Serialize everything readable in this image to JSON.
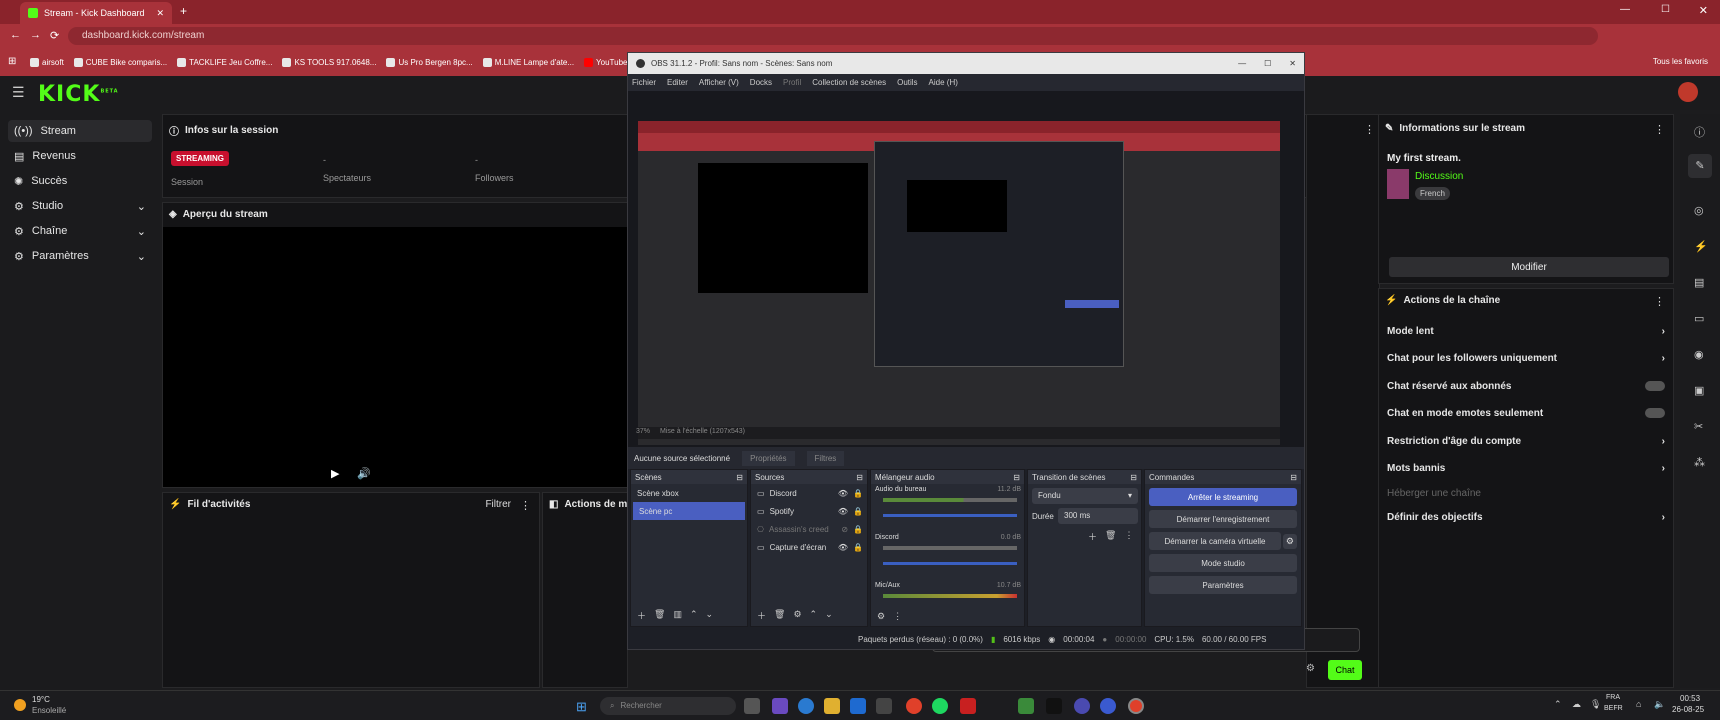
{
  "browser": {
    "tab_title": "Stream - Kick Dashboard",
    "url": "dashboard.kick.com/stream",
    "bookmarks": [
      "airsoft",
      "CUBE Bike comparis...",
      "TACKLIFE Jeu Coffre...",
      "KS TOOLS 917.0648...",
      "Us Pro Bergen 8pc...",
      "M.LINE Lampe d'ate...",
      "YouTube"
    ],
    "all_favorites": "Tous les favoris"
  },
  "kick": {
    "logo": "KICK",
    "logo_badge": "BETA",
    "nav": [
      {
        "label": "Stream",
        "icon": "broadcast-icon"
      },
      {
        "label": "Revenus",
        "icon": "money-icon"
      },
      {
        "label": "Succès",
        "icon": "trophy-icon"
      },
      {
        "label": "Studio",
        "icon": "gear-icon",
        "chevron": true
      },
      {
        "label": "Chaîne",
        "icon": "gear-icon",
        "chevron": true
      },
      {
        "label": "Paramètres",
        "icon": "gear-icon",
        "chevron": true
      }
    ],
    "session": {
      "title": "Infos sur la session",
      "badge": "STREAMING",
      "session_label": "Session",
      "viewers_dash": "-",
      "viewers_label": "Spectateurs",
      "followers_dash": "-",
      "followers_label": "Followers"
    },
    "preview": {
      "title": "Aperçu du stream"
    },
    "activity": {
      "title": "Fil d'activités",
      "filter": "Filtrer"
    },
    "mod_actions": {
      "title": "Actions de mod"
    },
    "stream_info": {
      "title": "Informations sur le stream",
      "stream_title": "My first stream.",
      "category": "Discussion",
      "language": "French",
      "edit": "Modifier"
    },
    "channel_actions": {
      "title": "Actions de la chaîne",
      "items": [
        {
          "label": "Mode lent",
          "control": "chevron"
        },
        {
          "label": "Chat pour les followers uniquement",
          "control": "chevron"
        },
        {
          "label": "Chat réservé aux abonnés",
          "control": "toggle"
        },
        {
          "label": "Chat en mode emotes seulement",
          "control": "toggle"
        },
        {
          "label": "Restriction d'âge du compte",
          "control": "chevron"
        },
        {
          "label": "Mots bannis",
          "control": "chevron"
        },
        {
          "label": "Héberger une chaîne",
          "control": "disabled"
        },
        {
          "label": "Définir des objectifs",
          "control": "chevron"
        }
      ]
    },
    "chat_button": "Chat"
  },
  "obs": {
    "title": "OBS 31.1.2 - Profil: Sans nom - Scènes: Sans nom",
    "menu": [
      "Fichier",
      "Editer",
      "Afficher (V)",
      "Docks",
      "Profil",
      "Collection de scènes",
      "Outils",
      "Aide (H)"
    ],
    "zoom": "37%",
    "scale": "Mise à l'échelle (1207x543)",
    "no_source": "Aucune source sélectionné",
    "properties": "Propriétés",
    "filters": "Filtres",
    "scenes": {
      "title": "Scènes",
      "items": [
        "Scène xbox",
        "Scène pc"
      ]
    },
    "sources": {
      "title": "Sources",
      "items": [
        "Discord",
        "Spotify",
        "Assassin's creed",
        "Capture d'écran"
      ]
    },
    "mixer": {
      "title": "Mélangeur audio",
      "channels": [
        {
          "name": "Audio du bureau",
          "db": "11.2 dB"
        },
        {
          "name": "Discord",
          "db": "0.0 dB"
        },
        {
          "name": "Mic/Aux",
          "db": "10.7 dB"
        }
      ]
    },
    "transitions": {
      "title": "Transition de scènes",
      "type": "Fondu",
      "duration_label": "Durée",
      "duration": "300 ms"
    },
    "controls": {
      "title": "Commandes",
      "buttons": [
        "Arrêter le streaming",
        "Démarrer l'enregistrement",
        "Démarrer la caméra virtuelle",
        "Mode studio",
        "Paramètres"
      ]
    },
    "status": {
      "dropped": "Paquets perdus (réseau) : 0 (0.0%)",
      "bitrate": "6016 kbps",
      "stream_time": "00:00:04",
      "rec_time": "00:00:00",
      "cpu": "CPU: 1.5%",
      "fps": "60.00 / 60.00 FPS"
    }
  },
  "taskbar": {
    "temp": "19°C",
    "weather": "Ensoleillé",
    "search": "Rechercher",
    "lang1": "FRA",
    "lang2": "BEFR",
    "time": "00:53",
    "date": "26-08-25"
  },
  "colors": {
    "accent_green": "#53fc18",
    "browser_red": "#a8323a",
    "streaming_badge": "#c8102e",
    "obs_blue": "#4a5fc1"
  }
}
